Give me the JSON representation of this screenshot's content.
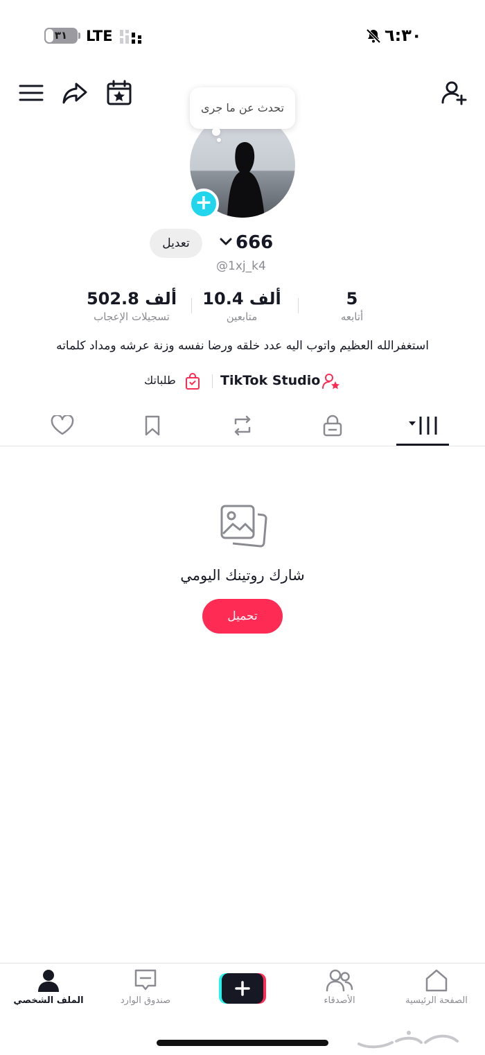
{
  "status_bar": {
    "battery": "٣١",
    "battery_level": 0.31,
    "network": "LTE",
    "time": "٦:٣٠"
  },
  "header": {
    "menu_icon": "menu-icon",
    "share_icon": "share-icon",
    "calendar_icon": "calendar-star-icon",
    "add_friend_icon": "add-user-icon"
  },
  "profile": {
    "bubble_text": "تحدث عن ما جرى",
    "edit_label": "تعديل",
    "display_name": "666",
    "username": "@1xj_k4",
    "stats": [
      {
        "value": "5",
        "label": "أتابعه"
      },
      {
        "value": "10.4 ألف",
        "label": "متابعين"
      },
      {
        "value": "502.8 ألف",
        "label": "تسجيلات الإعجاب"
      }
    ],
    "bio": "استغفرالله العظيم واتوب اليه عدد خلقه ورضا نفسه وزنة عرشه ومداد كلماته",
    "studio_label": "TikTok Studio",
    "orders_label": "طلباتك"
  },
  "tabs": [
    "videos-grid",
    "private-lock",
    "reposts",
    "favorites",
    "liked"
  ],
  "empty_state": {
    "text": "شارك روتينك اليومي",
    "button_label": "تحميل"
  },
  "bottom_nav": [
    {
      "label": "الملف الشخصي",
      "icon": "profile-icon",
      "active": true
    },
    {
      "label": "صندوق الوارد",
      "icon": "inbox-icon",
      "active": false
    },
    {
      "label": "",
      "icon": "create-plus-icon",
      "active": false
    },
    {
      "label": "الأصدقاء",
      "icon": "friends-icon",
      "active": false
    },
    {
      "label": "الصفحة الرئيسية",
      "icon": "home-icon",
      "active": false
    }
  ],
  "colors": {
    "accent": "#fe2c55",
    "avatar_plus": "#20d5ec",
    "text": "#161823",
    "secondary": "#8a8b91"
  }
}
